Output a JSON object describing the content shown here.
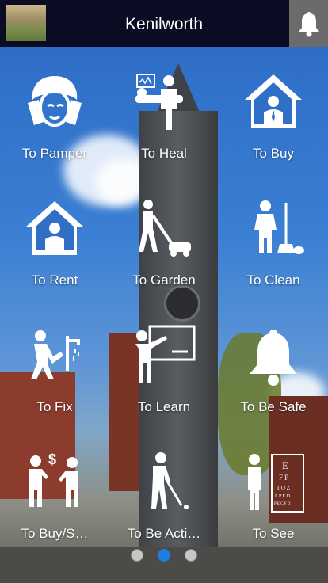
{
  "header": {
    "title": "Kenilworth"
  },
  "tiles": [
    {
      "label": "To Pamper",
      "icon": "pamper-face-icon"
    },
    {
      "label": "To Heal",
      "icon": "doctor-patient-icon"
    },
    {
      "label": "To Buy",
      "icon": "house-agent-icon"
    },
    {
      "label": "To Rent",
      "icon": "house-person-icon"
    },
    {
      "label": "To Garden",
      "icon": "lawnmower-icon"
    },
    {
      "label": "To Clean",
      "icon": "cleaner-broom-icon"
    },
    {
      "label": "To Fix",
      "icon": "plumber-wrench-icon"
    },
    {
      "label": "To Learn",
      "icon": "teacher-board-icon"
    },
    {
      "label": "To Be Safe",
      "icon": "bell-icon"
    },
    {
      "label": "To Buy/S…",
      "icon": "buy-sell-people-icon"
    },
    {
      "label": "To Be Acti…",
      "icon": "golfer-icon"
    },
    {
      "label": "To See",
      "icon": "optician-eye-chart-icon"
    }
  ],
  "pager": {
    "pages": 3,
    "active": 2
  }
}
